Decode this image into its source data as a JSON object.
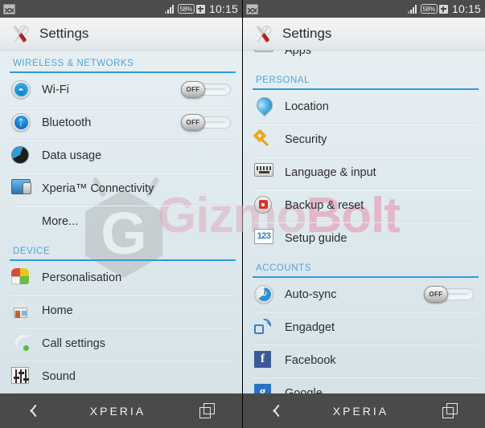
{
  "status_bar": {
    "notification_icon": "photo-icon",
    "signal_icon": "signal-bars-icon",
    "battery_text": "58%",
    "battery_charging_icon": "battery-charging-icon",
    "clock": "10:15"
  },
  "action_bar": {
    "icon": "tools-icon",
    "title": "Settings"
  },
  "nav_bar": {
    "back_icon": "back-chevron-icon",
    "brand": "XPERIA",
    "recents_icon": "recents-icon"
  },
  "toggle_off_label": "OFF",
  "watermark": {
    "logo_letter": "G",
    "text_part1": "Gizmo",
    "text_part2": "Bolt"
  },
  "colors": {
    "section_header": "#54a3d6",
    "section_rule": "#2f9ade",
    "status_bar": "#4c4c4c",
    "nav_bar": "#4a4a4a",
    "list_text": "#2e2e2e"
  },
  "left_screen": {
    "sections": [
      {
        "header": "WIRELESS & NETWORKS",
        "items": [
          {
            "label": "Wi-Fi",
            "icon": "wifi-icon",
            "toggle": "OFF"
          },
          {
            "label": "Bluetooth",
            "icon": "bluetooth-icon",
            "toggle": "OFF"
          },
          {
            "label": "Data usage",
            "icon": "data-usage-icon"
          },
          {
            "label": "Xperia™ Connectivity",
            "icon": "xperia-connectivity-icon"
          },
          {
            "label": "More...",
            "icon": null
          }
        ]
      },
      {
        "header": "DEVICE",
        "items": [
          {
            "label": "Personalisation",
            "icon": "personalisation-icon"
          },
          {
            "label": "Home",
            "icon": "home-icon"
          },
          {
            "label": "Call settings",
            "icon": "call-settings-icon"
          },
          {
            "label": "Sound",
            "icon": "sound-icon"
          }
        ]
      }
    ]
  },
  "right_screen": {
    "partial_top_item": {
      "label": "Apps",
      "icon": "apps-icon"
    },
    "sections": [
      {
        "header": "PERSONAL",
        "items": [
          {
            "label": "Location",
            "icon": "location-icon"
          },
          {
            "label": "Security",
            "icon": "security-icon"
          },
          {
            "label": "Language & input",
            "icon": "keyboard-icon"
          },
          {
            "label": "Backup & reset",
            "icon": "backup-reset-icon"
          },
          {
            "label": "Setup guide",
            "icon": "setup-guide-icon"
          }
        ]
      },
      {
        "header": "ACCOUNTS",
        "items": [
          {
            "label": "Auto-sync",
            "icon": "auto-sync-icon",
            "toggle": "OFF"
          },
          {
            "label": "Engadget",
            "icon": "engadget-icon"
          },
          {
            "label": "Facebook",
            "icon": "facebook-icon"
          },
          {
            "label": "Google",
            "icon": "google-icon"
          }
        ]
      }
    ]
  }
}
